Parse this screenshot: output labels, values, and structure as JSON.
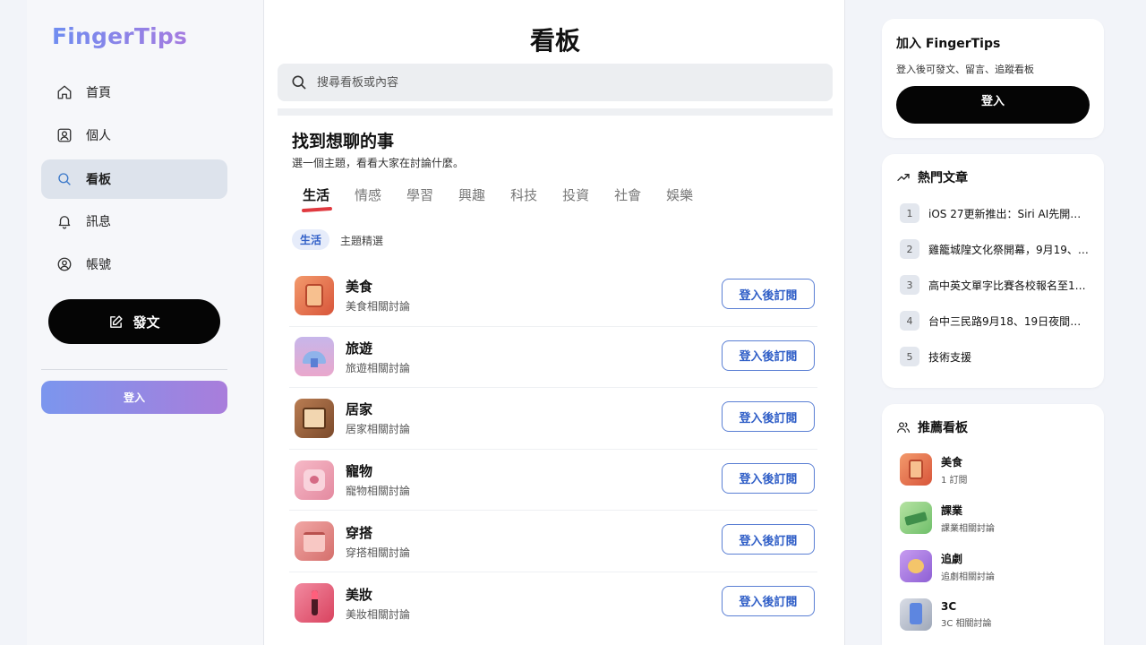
{
  "app": {
    "logo": "FingerTips"
  },
  "sidebar": {
    "items": [
      {
        "label": "首頁",
        "icon": "home-icon"
      },
      {
        "label": "個人",
        "icon": "profile-icon"
      },
      {
        "label": "看板",
        "icon": "search-icon",
        "active": true
      },
      {
        "label": "訊息",
        "icon": "bell-icon"
      },
      {
        "label": "帳號",
        "icon": "account-icon"
      }
    ],
    "post_button": "發文",
    "login_button": "登入"
  },
  "main": {
    "title": "看板",
    "search": {
      "placeholder": "搜尋看板或內容"
    },
    "section_title": "找到想聊的事",
    "section_subtitle": "選一個主題，看看大家在討論什麼。",
    "tabs": [
      "生活",
      "情感",
      "學習",
      "興趣",
      "科技",
      "投資",
      "社會",
      "娛樂"
    ],
    "active_tab": "生活",
    "chip": "生活",
    "chip_label": "主題精選",
    "boards": [
      {
        "name": "美食",
        "desc": "美食相關討論",
        "button": "登入後訂閱",
        "icon": "food-board-icon"
      },
      {
        "name": "旅遊",
        "desc": "旅遊相關討論",
        "button": "登入後訂閱",
        "icon": "travel-board-icon"
      },
      {
        "name": "居家",
        "desc": "居家相關討論",
        "button": "登入後訂閱",
        "icon": "home-board-icon"
      },
      {
        "name": "寵物",
        "desc": "寵物相關討論",
        "button": "登入後訂閱",
        "icon": "pet-board-icon"
      },
      {
        "name": "穿搭",
        "desc": "穿搭相關討論",
        "button": "登入後訂閱",
        "icon": "fashion-board-icon"
      },
      {
        "name": "美妝",
        "desc": "美妝相關討論",
        "button": "登入後訂閱",
        "icon": "makeup-board-icon"
      }
    ]
  },
  "right": {
    "join": {
      "title": "加入 FingerTips",
      "subtitle": "登入後可發文、留言、追蹤看板",
      "button": "登入"
    },
    "hot": {
      "title": "熱門文章",
      "items": [
        {
          "rank": "1",
          "text": "iOS 27更新推出：Siri AI先開…"
        },
        {
          "rank": "2",
          "text": "雞籠城隍文化祭開幕，9月19、…"
        },
        {
          "rank": "3",
          "text": "高中英文單字比賽各校報名至1…"
        },
        {
          "rank": "4",
          "text": "台中三民路9月18、19日夜間施…"
        },
        {
          "rank": "5",
          "text": "技術支援"
        }
      ]
    },
    "recommended": {
      "title": "推薦看板",
      "items": [
        {
          "name": "美食",
          "desc": "1 訂閱",
          "icon": "food-board-icon"
        },
        {
          "name": "課業",
          "desc": "課業相關討論",
          "icon": "study-board-icon"
        },
        {
          "name": "追劇",
          "desc": "追劇相關討論",
          "icon": "drama-board-icon"
        },
        {
          "name": "3C",
          "desc": "3C 相關討論",
          "icon": "tech-board-icon"
        }
      ]
    }
  },
  "colors": {
    "accent_blue": "#2f5ec7",
    "tab_underline": "#e0393f",
    "gradient_start": "#7b96ee",
    "gradient_end": "#a97ddb"
  }
}
